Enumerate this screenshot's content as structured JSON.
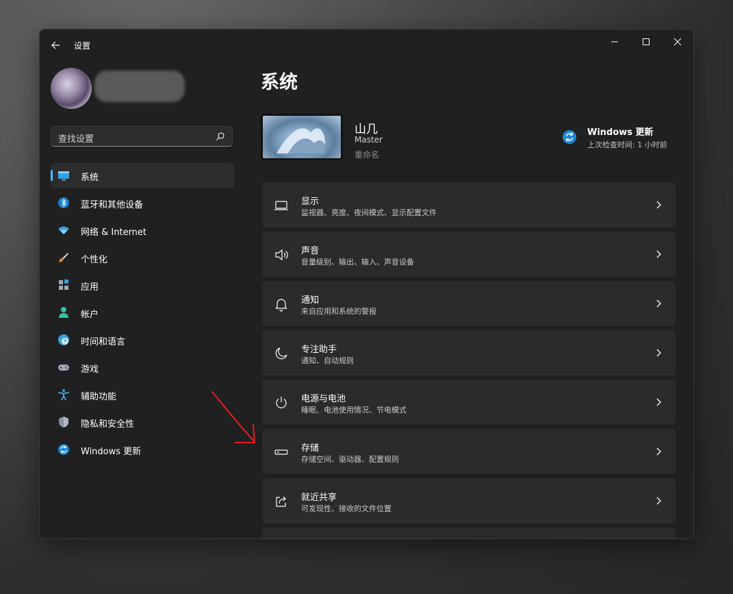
{
  "window": {
    "title": "设置"
  },
  "sidebar": {
    "search_placeholder": "查找设置",
    "items": [
      {
        "label": "系统",
        "icon": "display-icon",
        "active": true
      },
      {
        "label": "蓝牙和其他设备",
        "icon": "bluetooth-icon"
      },
      {
        "label": "网络 & Internet",
        "icon": "wifi-icon"
      },
      {
        "label": "个性化",
        "icon": "brush-icon"
      },
      {
        "label": "应用",
        "icon": "apps-icon"
      },
      {
        "label": "帐户",
        "icon": "account-icon"
      },
      {
        "label": "时间和语言",
        "icon": "time-language-icon"
      },
      {
        "label": "游戏",
        "icon": "gamepad-icon"
      },
      {
        "label": "辅助功能",
        "icon": "accessibility-icon"
      },
      {
        "label": "隐私和安全性",
        "icon": "shield-icon"
      },
      {
        "label": "Windows 更新",
        "icon": "windows-update-icon"
      }
    ]
  },
  "main": {
    "title": "系统",
    "device": {
      "name": "山几",
      "model": "Master",
      "rename": "重命名"
    },
    "update": {
      "title": "Windows 更新",
      "subtitle": "上次检查时间: 1 小时前"
    },
    "cards": [
      {
        "title": "显示",
        "subtitle": "监视器、亮度、夜间模式、显示配置文件",
        "icon": "monitor-icon"
      },
      {
        "title": "声音",
        "subtitle": "音量级别、输出、输入、声音设备",
        "icon": "speaker-icon"
      },
      {
        "title": "通知",
        "subtitle": "来自应用和系统的警报",
        "icon": "bell-icon"
      },
      {
        "title": "专注助手",
        "subtitle": "通知、自动规则",
        "icon": "moon-icon"
      },
      {
        "title": "电源与电池",
        "subtitle": "睡眠、电池使用情况、节电模式",
        "icon": "power-icon"
      },
      {
        "title": "存储",
        "subtitle": "存储空间、驱动器、配置规则",
        "icon": "storage-icon"
      },
      {
        "title": "就近共享",
        "subtitle": "可发现性、接收的文件位置",
        "icon": "share-icon"
      }
    ]
  },
  "colors": {
    "accent": "#4cc2ff",
    "annotation_arrow": "#e02020"
  }
}
